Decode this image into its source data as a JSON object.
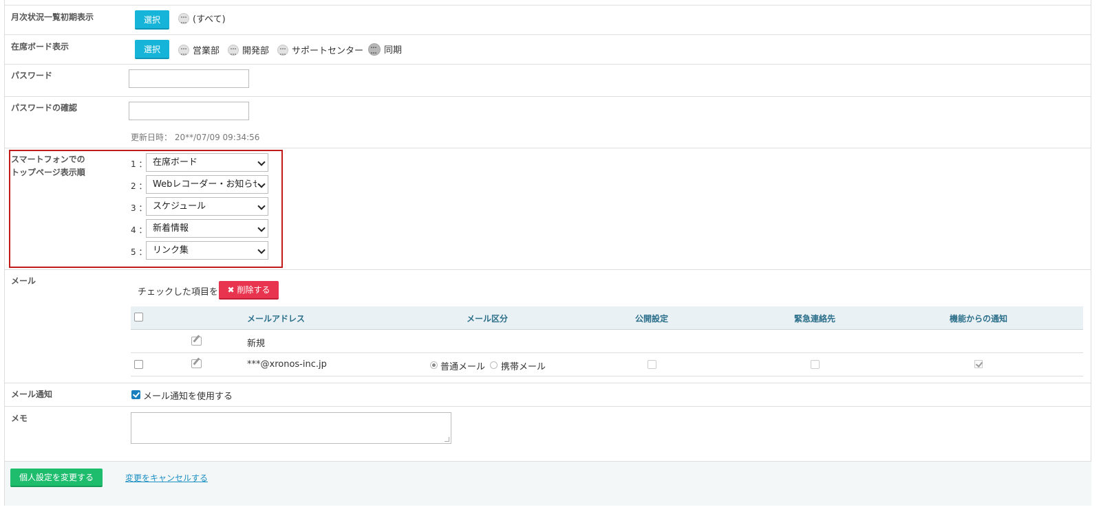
{
  "monthly_status": {
    "label": "月次状況一覧初期表示",
    "select_button": "選択",
    "groups": [
      "(すべて)"
    ]
  },
  "presence_board": {
    "label": "在席ボード表示",
    "select_button": "選択",
    "groups": [
      "営業部",
      "開発部",
      "サポートセンター",
      "同期"
    ]
  },
  "password": {
    "label": "パスワード",
    "value": ""
  },
  "password_confirm": {
    "label": "パスワードの確認",
    "value": ""
  },
  "updated_at": "更新日時： 20**/07/09 09:34:56",
  "smartphone_order": {
    "label_line1": "スマートフォンでの",
    "label_line2": "トップページ表示順",
    "items": [
      {
        "num": "1 ：",
        "value": "在席ボード"
      },
      {
        "num": "2 ：",
        "value": "Webレコーダー・お知らせ"
      },
      {
        "num": "3 ：",
        "value": "スケジュール"
      },
      {
        "num": "4 ：",
        "value": "新着情報"
      },
      {
        "num": "5 ：",
        "value": "リンク集"
      }
    ]
  },
  "mail": {
    "label": "メール",
    "checked_items_label": "チェックした項目を：",
    "delete_button": "削除する",
    "headers": [
      "メールアドレス",
      "メール区分",
      "公開設定",
      "緊急連絡先",
      "機能からの通知"
    ],
    "new_row_text": "新規",
    "rows": [
      {
        "address": "***@xronos-inc.jp",
        "type_normal": "普通メール",
        "type_mobile": "携帯メール",
        "selected_type": "普通メール",
        "public": false,
        "emergency": false,
        "notify": true
      }
    ]
  },
  "mail_notify": {
    "label": "メール通知",
    "checkbox_label": "メール通知を使用する",
    "checked": true
  },
  "memo": {
    "label": "メモ",
    "value": ""
  },
  "footer": {
    "submit_button": "個人設定を変更する",
    "cancel_link": "変更をキャンセルする"
  },
  "colors": {
    "select_button": "#17b4d9",
    "delete_button": "#e8344e",
    "submit_button": "#1ebd6e",
    "highlight_border": "#c11a1a",
    "link": "#1a8fc4"
  }
}
